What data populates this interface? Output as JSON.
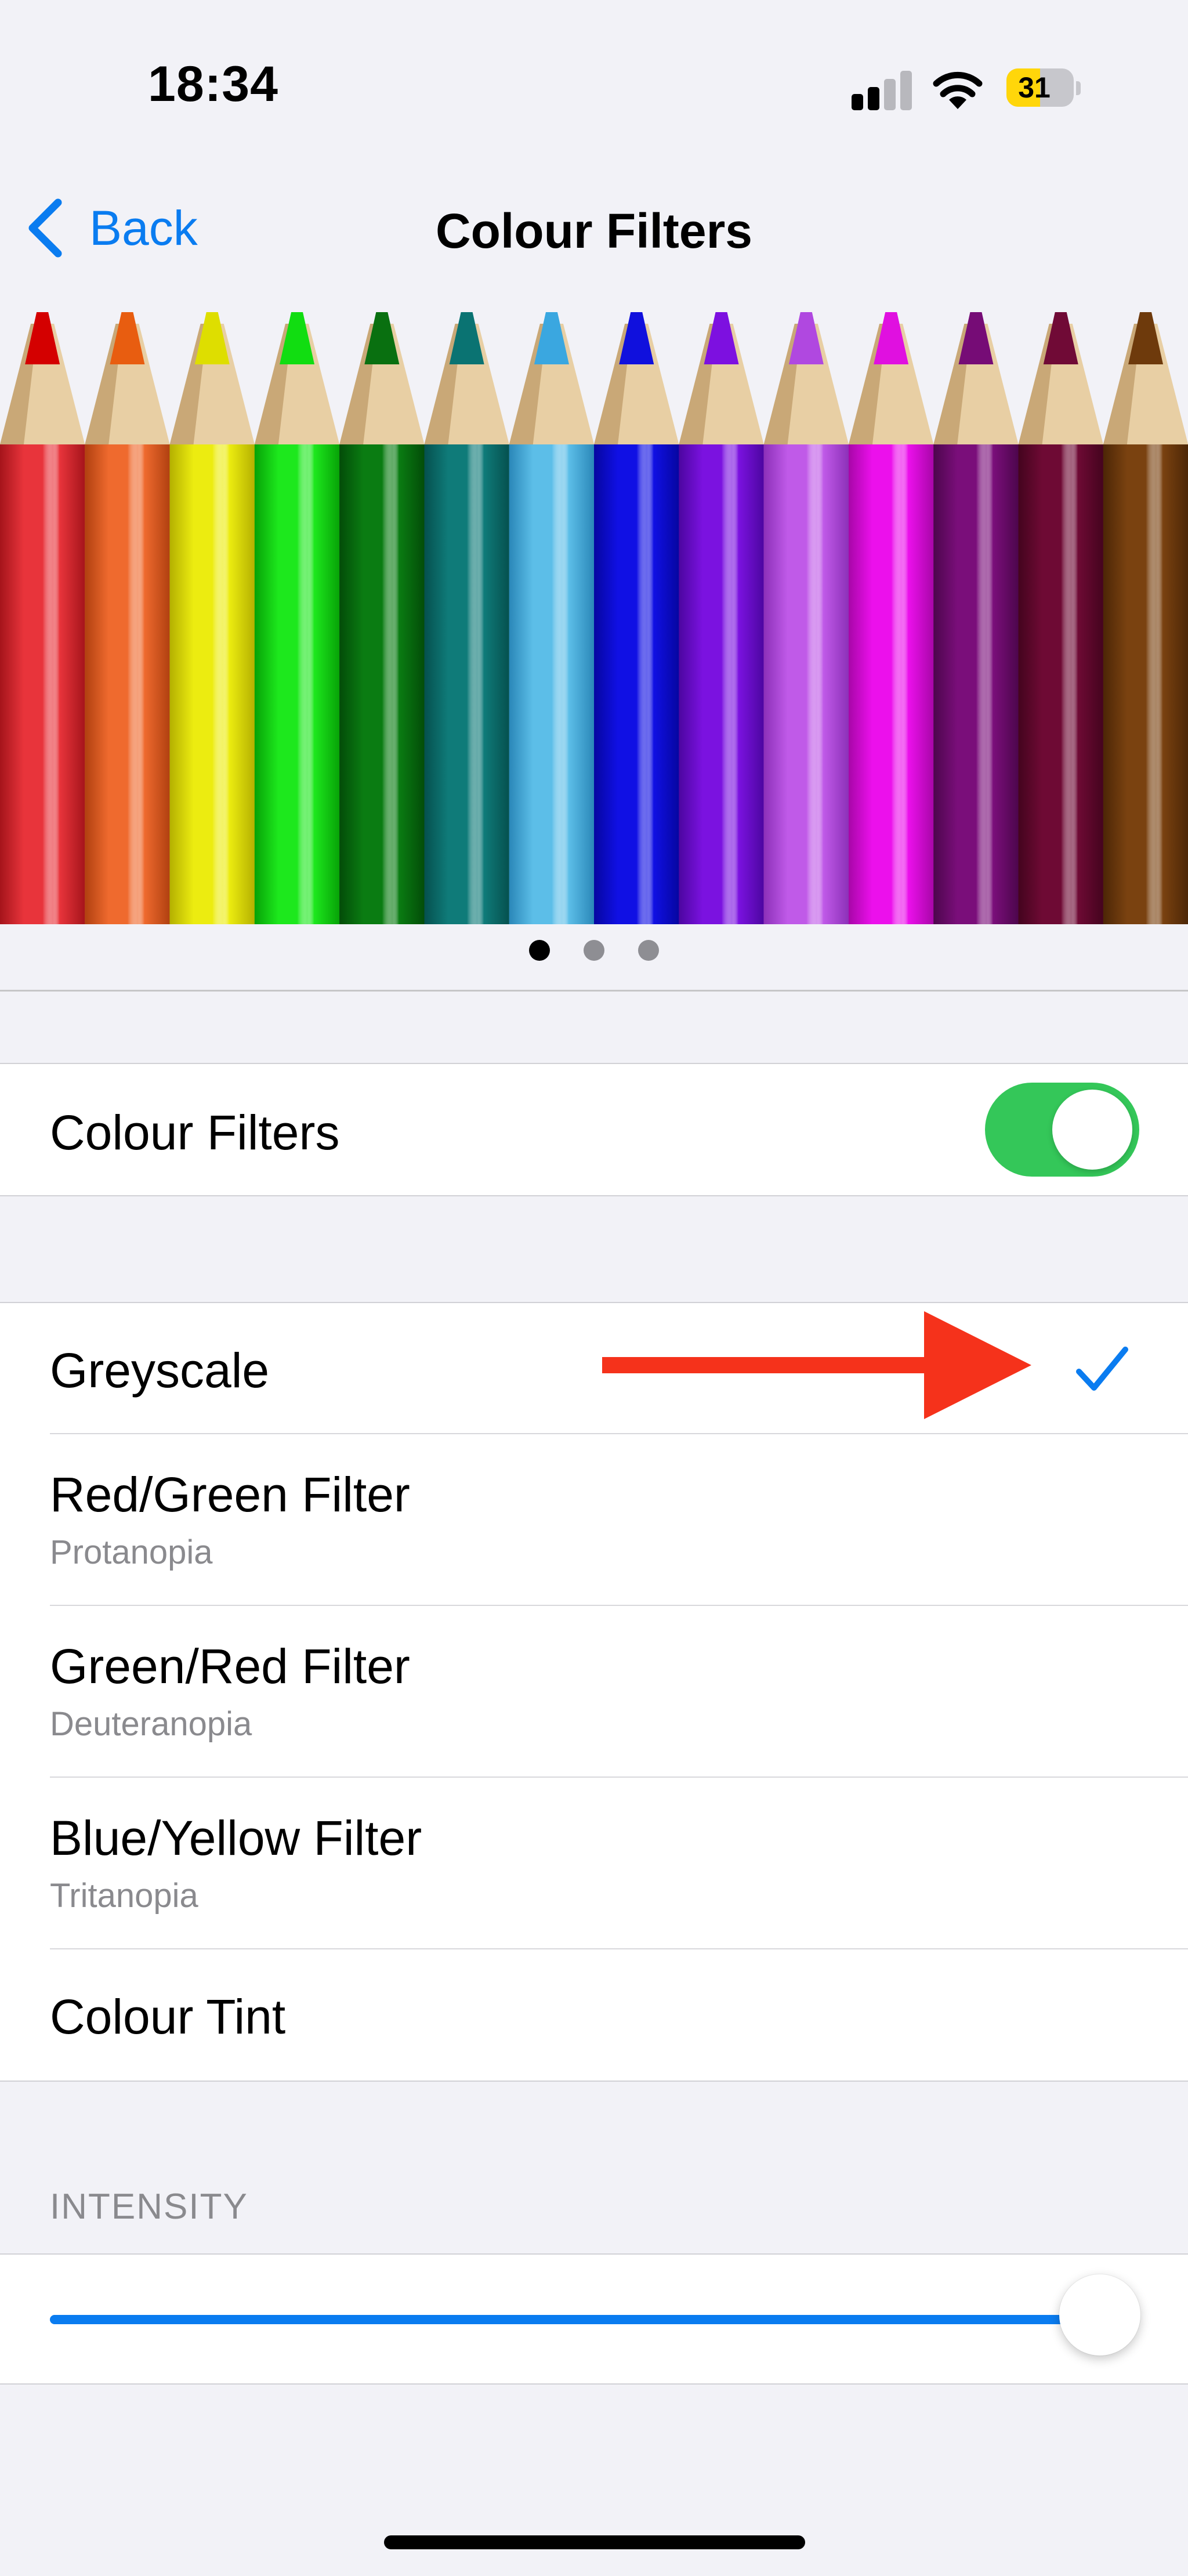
{
  "status_bar": {
    "time": "18:34",
    "battery_level": "31",
    "battery_color": "#ffd60a",
    "signal_bars_active": 2,
    "signal_bars_total": 4,
    "icons": [
      "signal-icon",
      "wifi-icon",
      "battery-icon"
    ]
  },
  "nav": {
    "back_label": "Back",
    "title": "Colour Filters"
  },
  "illustration": {
    "pencil_colors": [
      {
        "body": "#e8343b",
        "dark": "#a5141b",
        "tip": "#d40000"
      },
      {
        "body": "#ef6a2e",
        "dark": "#b04010",
        "tip": "#e85d10"
      },
      {
        "body": "#ecec10",
        "dark": "#b4b000",
        "tip": "#dede00"
      },
      {
        "body": "#1de81d",
        "dark": "#07a207",
        "tip": "#11dd11"
      },
      {
        "body": "#0a7c12",
        "dark": "#034c08",
        "tip": "#097010"
      },
      {
        "body": "#0f7b79",
        "dark": "#05504e",
        "tip": "#0a7372"
      },
      {
        "body": "#5cbee8",
        "dark": "#2a87b8",
        "tip": "#3aa7e0"
      },
      {
        "body": "#1010e4",
        "dark": "#0606a0",
        "tip": "#1010dd"
      },
      {
        "body": "#7b12e0",
        "dark": "#4c06a0",
        "tip": "#7d10e0"
      },
      {
        "body": "#c05ae8",
        "dark": "#8c30b8",
        "tip": "#b048e0"
      },
      {
        "body": "#ec10ec",
        "dark": "#a806a8",
        "tip": "#e010e0"
      },
      {
        "body": "#7a0e7a",
        "dark": "#4c064c",
        "tip": "#760c76"
      },
      {
        "body": "#6e0a34",
        "dark": "#44041e",
        "tip": "#700a36"
      },
      {
        "body": "#7a4210",
        "dark": "#4c2606",
        "tip": "#6e3a0c"
      }
    ],
    "wood_color": "#e8cfa4",
    "page_count": 3,
    "active_page": 0
  },
  "master_toggle": {
    "label": "Colour Filters",
    "on": true,
    "on_color": "#34c759"
  },
  "filters": {
    "selected": "Greyscale",
    "items": [
      {
        "label": "Greyscale",
        "sublabel": ""
      },
      {
        "label": "Red/Green Filter",
        "sublabel": "Protanopia"
      },
      {
        "label": "Green/Red Filter",
        "sublabel": "Deuteranopia"
      },
      {
        "label": "Blue/Yellow Filter",
        "sublabel": "Tritanopia"
      },
      {
        "label": "Colour Tint",
        "sublabel": ""
      }
    ],
    "checkmark_color": "#0a7cf0",
    "annotation_arrow_color": "#f5321b"
  },
  "intensity": {
    "header": "INTENSITY",
    "value_fraction": 1.0,
    "fill_color": "#0a7cf0"
  },
  "accent_color": "#0a7cf0"
}
